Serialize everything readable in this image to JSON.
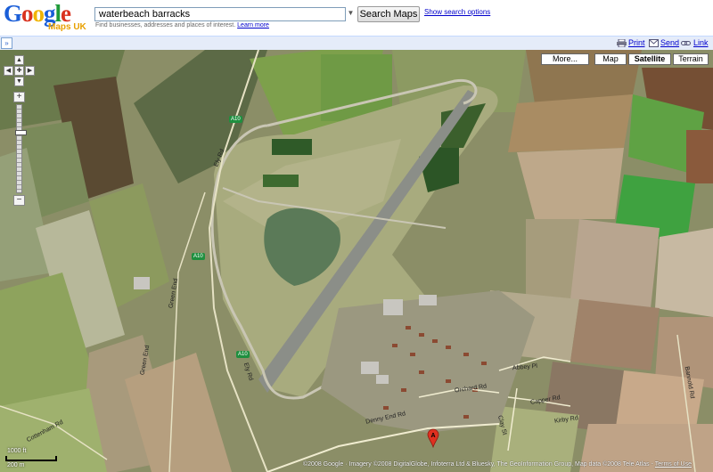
{
  "header": {
    "logo_text": "Google",
    "logo_sub": "Maps UK",
    "search_value": "waterbeach barracks",
    "search_button": "Search Maps",
    "search_options": "Show search options",
    "hint_text": "Find businesses, addresses and places of interest.",
    "learn_more": "Learn more"
  },
  "toolbar": {
    "collapse_label": "»",
    "print": "Print",
    "send": "Send",
    "link": "Link"
  },
  "map": {
    "type_buttons": [
      "More...",
      "Map",
      "Satellite",
      "Terrain"
    ],
    "active_type": "Satellite",
    "scale_top": "1000 ft",
    "scale_bottom": "200 m",
    "marker_letter": "A",
    "copyright": "©2008 Google · Imagery ©2008 DigitalGlobe, Infoterra Ltd & Bluesky, The GeoInformation Group, Map data ©2008 Tele Atlas -",
    "terms": "Terms of Use",
    "road_labels": {
      "a10_1": "A10",
      "a10_2": "A10",
      "a10_3": "A10",
      "ely_rd": "Ely Rd",
      "green_end": "Green End",
      "cottenham_rd": "Cottenham Rd",
      "denny_end_rd": "Denny End Rd",
      "orchard_rd": "Orchard Rd",
      "capper_rd": "Capper Rd",
      "abbey_pl": "Abbey Pl",
      "kirby_rd": "Kirby Rd",
      "clay_st": "Clay St",
      "bannold_rd": "Bannold Rd"
    }
  },
  "colors": {
    "brand_blue": "#0000cc",
    "toolbar_bg": "#e5ecf9",
    "road_shield": "#1f8f3f",
    "marker": "#e03020"
  }
}
